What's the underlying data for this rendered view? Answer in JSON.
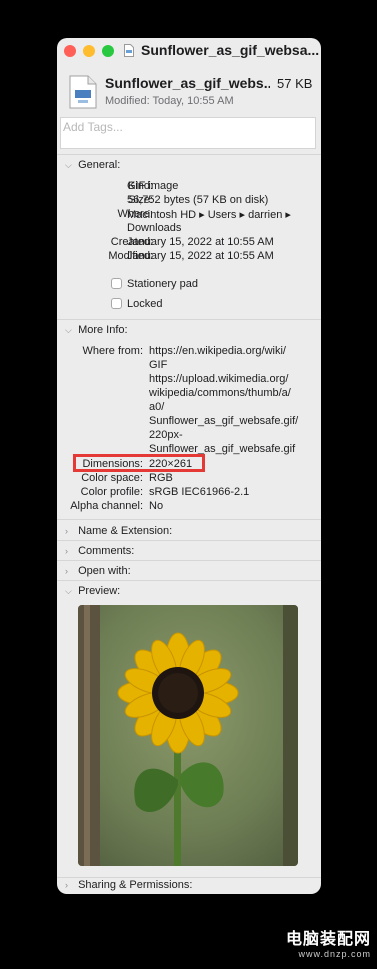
{
  "window": {
    "title": "Sunflower_as_gif_websa...",
    "file_name": "Sunflower_as_gif_webs...",
    "file_size": "57 KB",
    "modified": "Modified: Today, 10:55 AM",
    "tags_placeholder": "Add Tags..."
  },
  "general": {
    "header": "General:",
    "rows": [
      {
        "label": "Kind:",
        "value": "GIF image"
      },
      {
        "label": "Size:",
        "value": "56,752 bytes (57 KB on disk)"
      },
      {
        "label": "Where:",
        "value": "Macintosh HD ▸ Users ▸ darrien ▸",
        "value2": "Downloads"
      },
      {
        "label": "Created:",
        "value": "January 15, 2022 at 10:55 AM"
      },
      {
        "label": "Modified:",
        "value": "January 15, 2022 at 10:55 AM"
      }
    ],
    "stationery_label": "Stationery pad",
    "locked_label": "Locked"
  },
  "more_info": {
    "header": "More Info:",
    "where_from_label": "Where from:",
    "where_from_lines": [
      "https://en.wikipedia.org/wiki/",
      "GIF",
      "https://upload.wikimedia.org/",
      "wikipedia/commons/thumb/a/",
      "a0/",
      "Sunflower_as_gif_websafe.gif/",
      "220px-",
      "Sunflower_as_gif_websafe.gif"
    ],
    "rows": [
      {
        "label": "Dimensions:",
        "value": "220×261"
      },
      {
        "label": "Color space:",
        "value": "RGB"
      },
      {
        "label": "Color profile:",
        "value": "sRGB IEC61966-2.1"
      },
      {
        "label": "Alpha channel:",
        "value": "No"
      }
    ]
  },
  "sections": {
    "name_ext": "Name & Extension:",
    "comments": "Comments:",
    "open_with": "Open with:",
    "preview": "Preview:",
    "sharing": "Sharing & Permissions:"
  },
  "watermark": {
    "line1": "电脑装配网",
    "line2": "www.dnzp.com"
  },
  "colors": {
    "highlight": "#e53935",
    "window_bg": "#ececec"
  }
}
